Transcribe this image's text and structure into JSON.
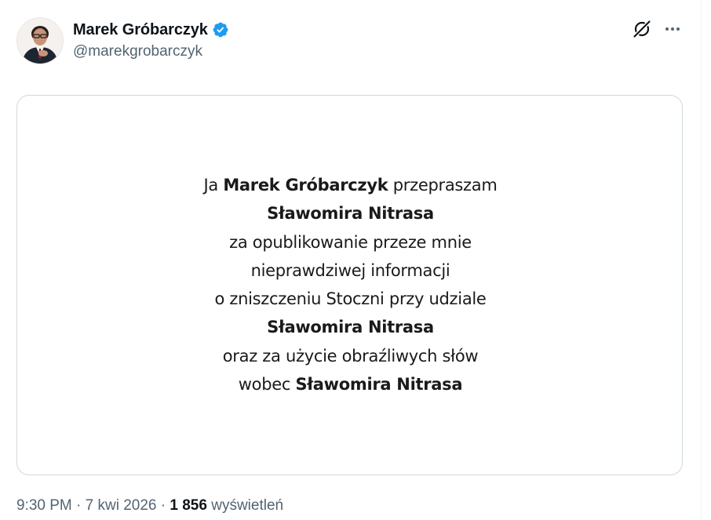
{
  "author": {
    "display_name": "Marek Gróbarczyk",
    "handle": "@marekgrobarczyk",
    "verified": true
  },
  "actions": {
    "grok_icon": "grok-icon",
    "more_icon": "more-horizontal-icon"
  },
  "media_text": {
    "l1_pre": "Ja ",
    "l1_bold": "Marek Gróbarczyk",
    "l1_post": " przepraszam",
    "l2": "Sławomira Nitrasa",
    "l3": "za opublikowanie przeze mnie",
    "l4": "nieprawdziwej informacji",
    "l5": "o zniszczeniu Stoczni przy udziale",
    "l6": "Sławomira Nitrasa",
    "l7": "oraz za użycie obraźliwych słów",
    "l8_pre": "wobec ",
    "l8_bold": "Sławomira Nitrasa"
  },
  "meta": {
    "time": "9:30 PM",
    "sep1": " · ",
    "date": "7 kwi 2026",
    "sep2": " · ",
    "views_count": "1 856",
    "views_label": " wyświetleń"
  },
  "colors": {
    "text_primary": "#0f1419",
    "text_secondary": "#536471",
    "verified_blue": "#1d9bf0",
    "border": "#cfd9de"
  }
}
